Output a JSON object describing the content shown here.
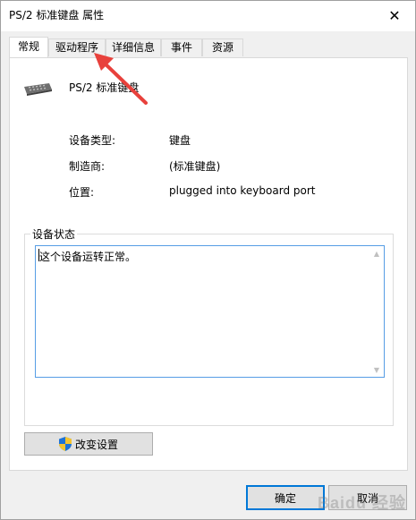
{
  "window": {
    "title": "PS/2 标准键盘 属性",
    "close_glyph": "✕"
  },
  "tabs": [
    {
      "label": "常规",
      "active": true
    },
    {
      "label": "驱动程序",
      "active": false
    },
    {
      "label": "详细信息",
      "active": false
    },
    {
      "label": "事件",
      "active": false
    },
    {
      "label": "资源",
      "active": false
    }
  ],
  "device": {
    "name": "PS/2 标准键盘",
    "icon": "keyboard-icon"
  },
  "properties": [
    {
      "label": "设备类型:",
      "value": "键盘"
    },
    {
      "label": "制造商:",
      "value": "(标准键盘)"
    },
    {
      "label": "位置:",
      "value": "plugged into keyboard port"
    }
  ],
  "status": {
    "group_title": "设备状态",
    "text": "这个设备运转正常。"
  },
  "buttons": {
    "change_settings": "改变设置",
    "ok": "确定",
    "cancel": "取消"
  },
  "annotation": {
    "arrow_color": "#e8413c"
  },
  "watermark": {
    "text": "Baidu 经验"
  }
}
